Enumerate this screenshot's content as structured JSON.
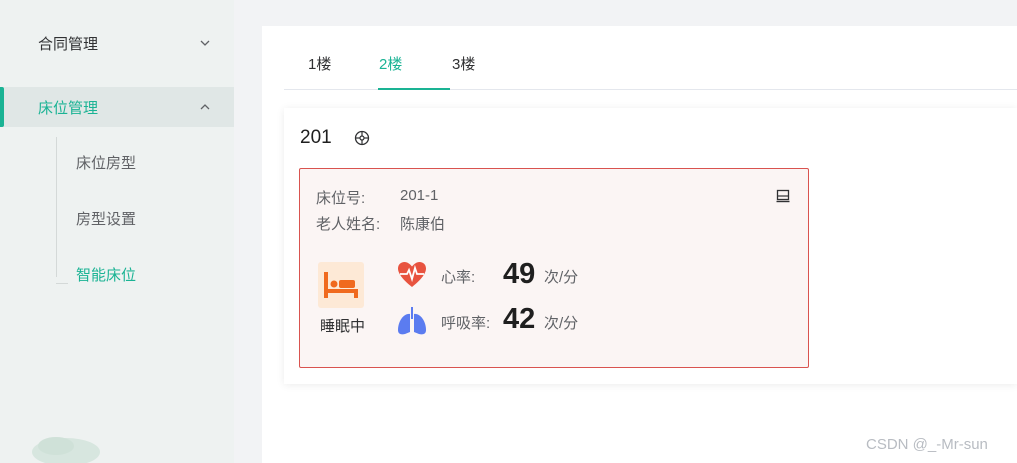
{
  "sidebar": {
    "groups": [
      {
        "label": "合同管理",
        "expanded": false
      },
      {
        "label": "床位管理",
        "expanded": true
      }
    ],
    "sub_items": [
      {
        "label": "床位房型"
      },
      {
        "label": "房型设置"
      },
      {
        "label": "智能床位",
        "active": true
      }
    ]
  },
  "tabs": [
    {
      "label": "1楼"
    },
    {
      "label": "2楼",
      "active": true
    },
    {
      "label": "3楼"
    }
  ],
  "room": {
    "number": "201",
    "icon": "settings-wheel-icon",
    "bed": {
      "bed_no_label": "床位号:",
      "bed_no": "201-1",
      "name_label": "老人姓名:",
      "name": "陈康伯",
      "status": "睡眠中",
      "heart_rate_label": "心率:",
      "heart_rate": "49",
      "heart_rate_unit": "次/分",
      "breath_rate_label": "呼吸率:",
      "breath_rate": "42",
      "breath_rate_unit": "次/分"
    }
  },
  "colors": {
    "accent": "#1ab394",
    "alert_border": "#d9534f",
    "heart": "#e8533f",
    "lungs": "#5b7cf0",
    "bed": "#f06a1e"
  },
  "watermark": "CSDN @_-Mr-sun"
}
